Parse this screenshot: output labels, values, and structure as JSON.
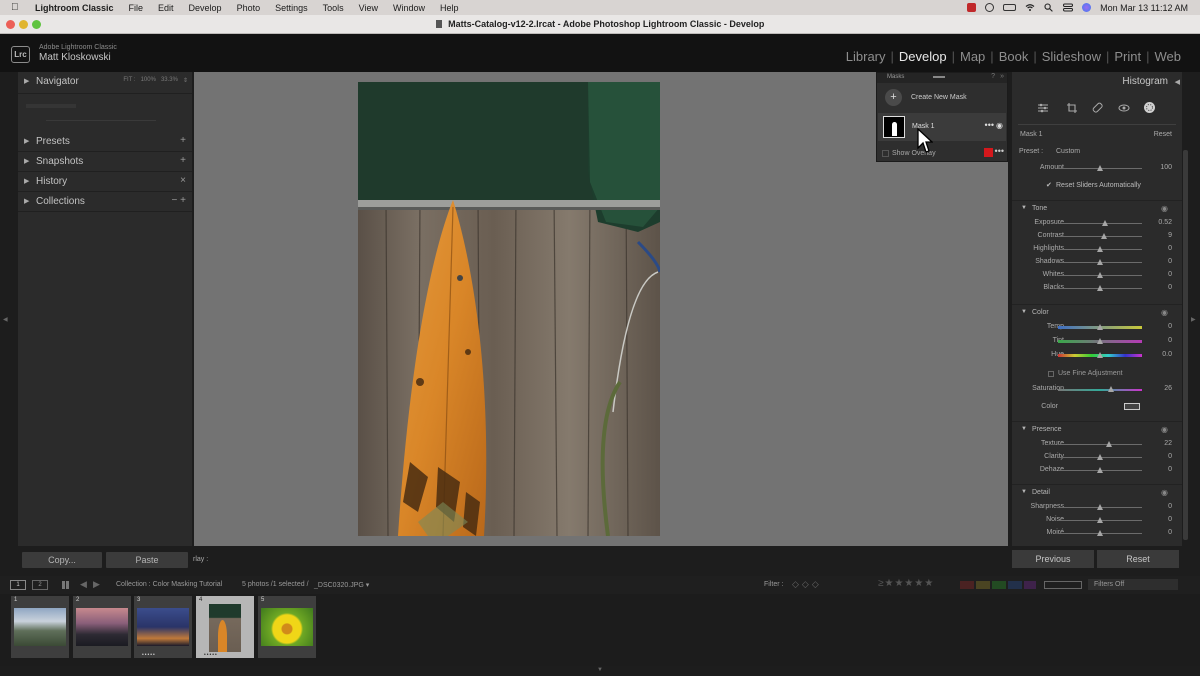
{
  "menubar": {
    "app": "Lightroom Classic",
    "items": [
      "File",
      "Edit",
      "Develop",
      "Photo",
      "Settings",
      "Tools",
      "View",
      "Window",
      "Help"
    ],
    "clock": "Mon Mar 13  11:12 AM"
  },
  "window": {
    "title": "Matts-Catalog-v12-2.lrcat - Adobe Photoshop Lightroom Classic - Develop"
  },
  "header": {
    "logo": "Lrc",
    "product": "Adobe Lightroom Classic",
    "user": "Matt Kloskowski",
    "modules": [
      "Library",
      "Develop",
      "Map",
      "Book",
      "Slideshow",
      "Print",
      "Web"
    ],
    "active_module": "Develop"
  },
  "left_panel": {
    "navigator": {
      "label": "Navigator",
      "opts": [
        "FIT :",
        "100%",
        "33.3%",
        "⇕"
      ]
    },
    "sections": [
      {
        "label": "Presets",
        "action": "+"
      },
      {
        "label": "Snapshots",
        "action": "+"
      },
      {
        "label": "History",
        "action": "×"
      },
      {
        "label": "Collections",
        "action": "−  +"
      }
    ],
    "copy_label": "Copy...",
    "paste_label": "Paste",
    "overlay_text": "rlay :"
  },
  "masks_panel": {
    "title": "Masks",
    "create_label": "Create New Mask",
    "mask_name": "Mask 1",
    "show_overlay": "Show Overlay"
  },
  "right_panel": {
    "histogram_label": "Histogram",
    "mask_header": {
      "name": "Mask 1",
      "reset": "Reset"
    },
    "preset": {
      "label": "Preset :",
      "value": "Custom"
    },
    "amount": {
      "label": "Amount",
      "value": "100"
    },
    "reset_sliders": "Reset Sliders Automatically",
    "tone": {
      "label": "Tone",
      "rows": [
        {
          "label": "Exposure",
          "value": "0.52",
          "pos": 0.56
        },
        {
          "label": "Contrast",
          "value": "9",
          "pos": 0.55
        },
        {
          "label": "Highlights",
          "value": "0",
          "pos": 0.5
        },
        {
          "label": "Shadows",
          "value": "0",
          "pos": 0.5
        },
        {
          "label": "Whites",
          "value": "0",
          "pos": 0.5
        },
        {
          "label": "Blacks",
          "value": "0",
          "pos": 0.5
        }
      ]
    },
    "color": {
      "label": "Color",
      "rows": [
        {
          "label": "Temp",
          "value": "0",
          "pos": 0.5
        },
        {
          "label": "Tint",
          "value": "0",
          "pos": 0.5
        },
        {
          "label": "Hue",
          "value": "0.0",
          "pos": 0.5
        }
      ],
      "fine_adjust": "Use Fine Adjustment",
      "saturation": {
        "label": "Saturation",
        "value": "26",
        "pos": 0.63
      },
      "color_label": "Color"
    },
    "presence": {
      "label": "Presence",
      "rows": [
        {
          "label": "Texture",
          "value": "22",
          "pos": 0.61
        },
        {
          "label": "Clarity",
          "value": "0",
          "pos": 0.5
        },
        {
          "label": "Dehaze",
          "value": "0",
          "pos": 0.5
        }
      ]
    },
    "detail": {
      "label": "Detail",
      "rows": [
        {
          "label": "Sharpness",
          "value": "0",
          "pos": 0.5
        },
        {
          "label": "Noise",
          "value": "0",
          "pos": 0.5
        },
        {
          "label": "Moiré",
          "value": "0",
          "pos": 0.5
        }
      ]
    },
    "previous_label": "Previous",
    "reset_label": "Reset"
  },
  "filmbar": {
    "screens": [
      "1",
      "2"
    ],
    "source": "Collection : Color Masking Tutorial",
    "count": "5 photos /1 selected /",
    "filename": "_DSC0320.JPG ▾",
    "filter_label": "Filter :",
    "filters_off": "Filters Off"
  },
  "filmstrip": {
    "cells": [
      {
        "num": "1",
        "stars": ""
      },
      {
        "num": "2",
        "stars": ""
      },
      {
        "num": "3",
        "stars": "•••••"
      },
      {
        "num": "4",
        "stars": "•••••"
      },
      {
        "num": "5",
        "stars": ""
      }
    ],
    "selected_index": 3
  },
  "colors": {
    "active_module": "#e8e8e8",
    "canvas_bg": "#737373",
    "panel_bg": "#2b2b2b",
    "overlay_swatch": "#d4181c"
  }
}
